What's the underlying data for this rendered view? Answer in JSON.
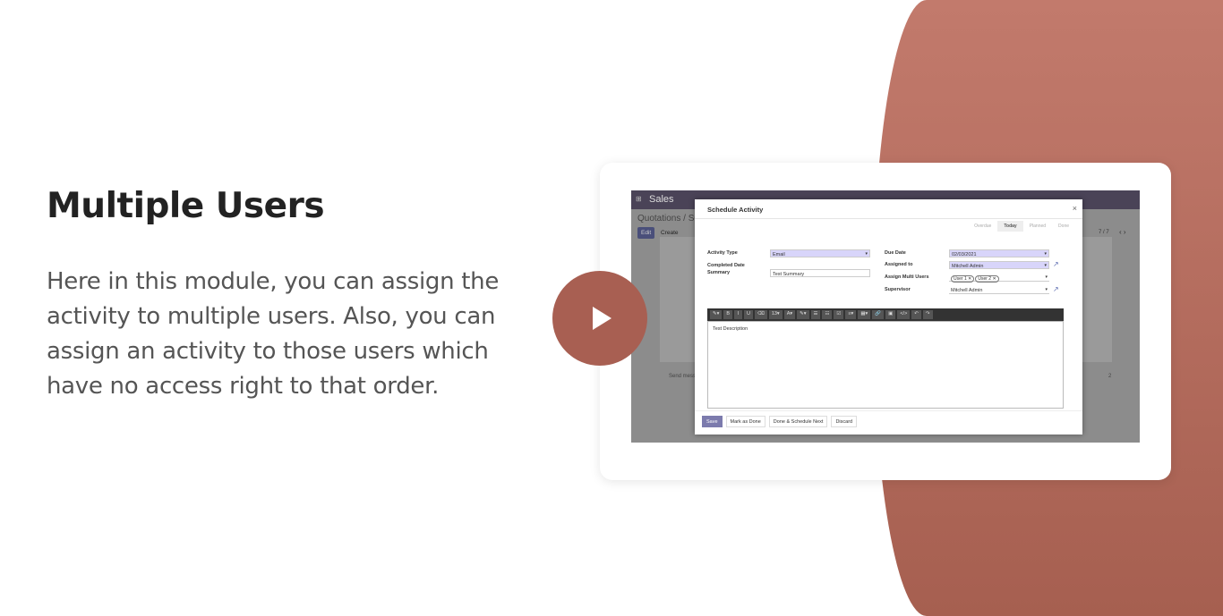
{
  "heading": "Multiple Users",
  "description": "Here in this module, you can assign the activity to multiple users. Also, you can assign an activity to those users which have no access right to that order.",
  "app": {
    "name": "Sales",
    "breadcrumb": "Quotations / S000",
    "edit": "Edit",
    "create": "Create",
    "pager": "7 / 7",
    "send_message": "Send mess",
    "followers": "2"
  },
  "modal": {
    "title": "Schedule Activity",
    "close": "×",
    "steps": [
      "Overdue",
      "Today",
      "Planned",
      "Done"
    ],
    "activity_type_label": "Activity Type",
    "activity_type": "Email",
    "completed_label": "Completed Date Summary",
    "summary": "Test Summary",
    "due_label": "Due Date",
    "due": "02/03/2021",
    "assigned_label": "Assigned to",
    "assigned": "Mitchell Admin",
    "multi_label": "Assign Multi Users",
    "multi": [
      "User 1",
      "User 2"
    ],
    "supervisor_label": "Supervisor",
    "supervisor": "Mitchell Admin",
    "toolbar": [
      "✎▾",
      "B",
      "I",
      "U",
      "⌫",
      "13▾",
      "A▾",
      "✎▾",
      "☰",
      "☷",
      "☑",
      "≡▾",
      "▦▾",
      "🔗",
      "▣",
      "</>",
      "↶",
      "↷"
    ],
    "description": "Test Description",
    "buttons": {
      "save": "Save",
      "mark_done": "Mark as Done",
      "done_next": "Done & Schedule Next",
      "discard": "Discard"
    }
  },
  "colors": {
    "accent": "#a85f52",
    "odoo": "#7c7bad"
  }
}
